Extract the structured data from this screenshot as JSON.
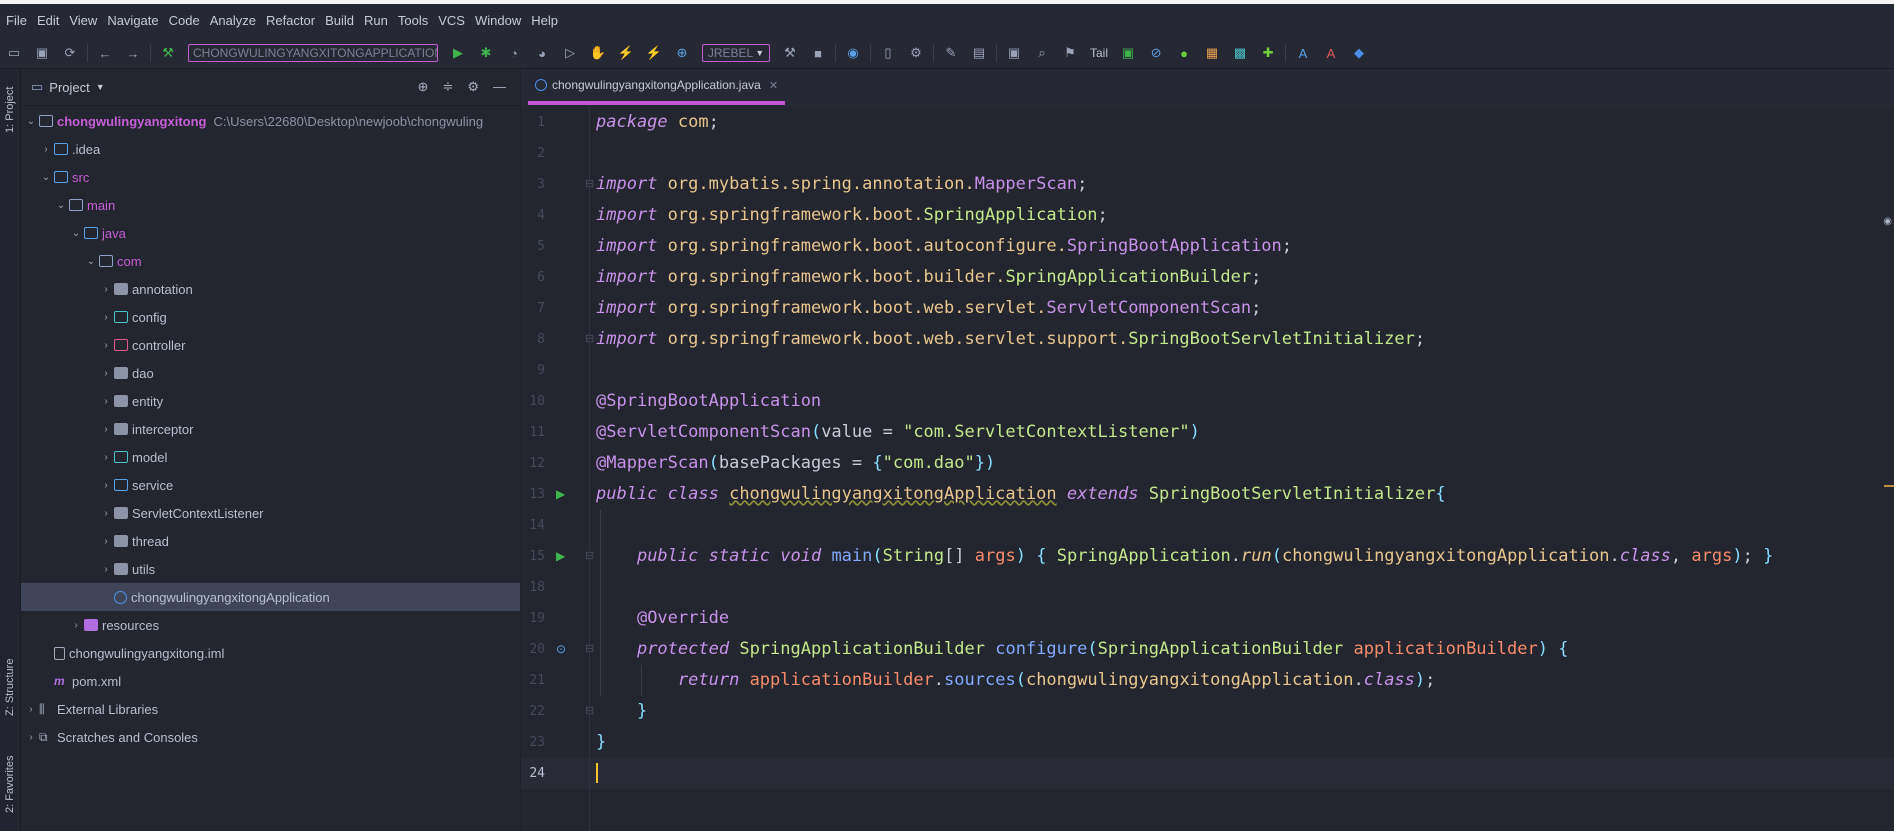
{
  "menu": [
    "File",
    "Edit",
    "View",
    "Navigate",
    "Code",
    "Analyze",
    "Refactor",
    "Build",
    "Run",
    "Tools",
    "VCS",
    "Window",
    "Help"
  ],
  "toolbar": {
    "run_config": "CHONGWULINGYANGXITONGAPPLICATION",
    "jrebel": "JREBEL",
    "tail": "Tail"
  },
  "left_strip": {
    "project_tab": "1: Project",
    "structure_tab": "Z: Structure",
    "favorites_tab": "2: Favorites"
  },
  "project_panel": {
    "title": "Project",
    "tree": [
      {
        "label": "chongwulingyangxitong",
        "path": "C:\\Users\\22680\\Desktop\\newjoob\\chongwuling",
        "depth": 0,
        "expanded": true,
        "icon": "folder-icon"
      },
      {
        "label": ".idea",
        "depth": 1,
        "expanded": false,
        "icon": "folder-blue-icon"
      },
      {
        "label": "src",
        "depth": 1,
        "expanded": true,
        "icon": "folder-src-icon"
      },
      {
        "label": "main",
        "depth": 2,
        "expanded": true,
        "icon": "folder-icon"
      },
      {
        "label": "java",
        "depth": 3,
        "expanded": true,
        "icon": "folder-blue-icon"
      },
      {
        "label": "com",
        "depth": 4,
        "expanded": true,
        "icon": "folder-icon"
      },
      {
        "label": "annotation",
        "depth": 5,
        "expanded": false,
        "icon": "package-icon"
      },
      {
        "label": "config",
        "depth": 5,
        "expanded": false,
        "icon": "package-config-icon"
      },
      {
        "label": "controller",
        "depth": 5,
        "expanded": false,
        "icon": "package-controller-icon"
      },
      {
        "label": "dao",
        "depth": 5,
        "expanded": false,
        "icon": "package-icon"
      },
      {
        "label": "entity",
        "depth": 5,
        "expanded": false,
        "icon": "package-icon"
      },
      {
        "label": "interceptor",
        "depth": 5,
        "expanded": false,
        "icon": "package-icon"
      },
      {
        "label": "model",
        "depth": 5,
        "expanded": false,
        "icon": "package-model-icon"
      },
      {
        "label": "service",
        "depth": 5,
        "expanded": false,
        "icon": "package-service-icon"
      },
      {
        "label": "ServletContextListener",
        "depth": 5,
        "expanded": false,
        "icon": "package-icon"
      },
      {
        "label": "thread",
        "depth": 5,
        "expanded": false,
        "icon": "package-icon"
      },
      {
        "label": "utils",
        "depth": 5,
        "expanded": false,
        "icon": "package-icon"
      },
      {
        "label": "chongwulingyangxitongApplication",
        "depth": 5,
        "leaf": true,
        "selected": true,
        "icon": "spring-class-icon"
      },
      {
        "label": "resources",
        "depth": 3,
        "expanded": false,
        "icon": "resources-folder-icon"
      },
      {
        "label": "chongwulingyangxitong.iml",
        "depth": 1,
        "leaf": true,
        "icon": "iml-file-icon"
      },
      {
        "label": "pom.xml",
        "depth": 1,
        "leaf": true,
        "icon": "maven-icon"
      },
      {
        "label": "External Libraries",
        "depth": 0,
        "expanded": false,
        "icon": "library-icon"
      },
      {
        "label": "Scratches and Consoles",
        "depth": 0,
        "expanded": false,
        "icon": "scratches-icon"
      }
    ]
  },
  "editor": {
    "tab_label": "chongwulingyangxitongApplication.java",
    "current_line": 24,
    "lines": [
      {
        "n": 1,
        "tokens": [
          [
            "kw",
            "package"
          ],
          [
            "plain",
            " "
          ],
          [
            "pkg",
            "com"
          ],
          [
            "plain",
            ";"
          ]
        ]
      },
      {
        "n": 2,
        "tokens": []
      },
      {
        "n": 3,
        "tokens": [
          [
            "kw",
            "import"
          ],
          [
            "plain",
            " "
          ],
          [
            "pkg",
            "org.mybatis.spring.annotation."
          ],
          [
            "ann",
            "MapperScan"
          ],
          [
            "plain",
            ";"
          ]
        ]
      },
      {
        "n": 4,
        "tokens": [
          [
            "kw",
            "import"
          ],
          [
            "plain",
            " "
          ],
          [
            "pkg",
            "org.springframework.boot."
          ],
          [
            "cls",
            "SpringApplication"
          ],
          [
            "plain",
            ";"
          ]
        ]
      },
      {
        "n": 5,
        "tokens": [
          [
            "kw",
            "import"
          ],
          [
            "plain",
            " "
          ],
          [
            "pkg",
            "org.springframework.boot.autoconfigure."
          ],
          [
            "ann",
            "SpringBootApplication"
          ],
          [
            "plain",
            ";"
          ]
        ]
      },
      {
        "n": 6,
        "tokens": [
          [
            "kw",
            "import"
          ],
          [
            "plain",
            " "
          ],
          [
            "pkg",
            "org.springframework.boot.builder."
          ],
          [
            "cls",
            "SpringApplicationBuilder"
          ],
          [
            "plain",
            ";"
          ]
        ]
      },
      {
        "n": 7,
        "tokens": [
          [
            "kw",
            "import"
          ],
          [
            "plain",
            " "
          ],
          [
            "pkg",
            "org.springframework.boot.web.servlet."
          ],
          [
            "ann",
            "ServletComponentScan"
          ],
          [
            "plain",
            ";"
          ]
        ]
      },
      {
        "n": 8,
        "tokens": [
          [
            "kw",
            "import"
          ],
          [
            "plain",
            " "
          ],
          [
            "pkg",
            "org.springframework.boot.web.servlet.support."
          ],
          [
            "cls",
            "SpringBootServletInitializer"
          ],
          [
            "plain",
            ";"
          ]
        ]
      },
      {
        "n": 9,
        "tokens": []
      },
      {
        "n": 10,
        "tokens": [
          [
            "ann",
            "@SpringBootApplication"
          ]
        ]
      },
      {
        "n": 11,
        "tokens": [
          [
            "ann",
            "@ServletComponentScan"
          ],
          [
            "brace",
            "("
          ],
          [
            "plain",
            "value = "
          ],
          [
            "str",
            "\"com.ServletContextListener\""
          ],
          [
            "brace",
            ")"
          ]
        ]
      },
      {
        "n": 12,
        "tokens": [
          [
            "ann",
            "@MapperScan"
          ],
          [
            "brace",
            "("
          ],
          [
            "plain",
            "basePackages = "
          ],
          [
            "brace",
            "{"
          ],
          [
            "str",
            "\"com.dao\""
          ],
          [
            "brace",
            "})"
          ]
        ]
      },
      {
        "n": 13,
        "tokens": [
          [
            "kw",
            "public class"
          ],
          [
            "plain",
            " "
          ],
          [
            "clsdecl",
            "chongwulingyangxitongApplication"
          ],
          [
            "plain",
            " "
          ],
          [
            "kw",
            "extends"
          ],
          [
            "plain",
            " "
          ],
          [
            "cls",
            "SpringBootServletInitializer"
          ],
          [
            "brace",
            "{"
          ]
        ]
      },
      {
        "n": 14,
        "tokens": []
      },
      {
        "n": 15,
        "tokens": [
          [
            "plain",
            "    "
          ],
          [
            "kw",
            "public static void"
          ],
          [
            "plain",
            " "
          ],
          [
            "fn",
            "main"
          ],
          [
            "brace",
            "("
          ],
          [
            "cls",
            "String"
          ],
          [
            "plain",
            "[] "
          ],
          [
            "param",
            "args"
          ],
          [
            "brace",
            ")"
          ],
          [
            "plain",
            " "
          ],
          [
            "brace",
            "{"
          ],
          [
            "plain",
            " "
          ],
          [
            "cls",
            "SpringApplication"
          ],
          [
            "plain",
            "."
          ],
          [
            "fnit",
            "run"
          ],
          [
            "brace",
            "("
          ],
          [
            "pkg",
            "chongwulingyangxitongApplication"
          ],
          [
            "plain",
            "."
          ],
          [
            "kw",
            "class"
          ],
          [
            "plain",
            ", "
          ],
          [
            "param",
            "args"
          ],
          [
            "brace",
            ")"
          ],
          [
            "plain",
            "; "
          ],
          [
            "brace",
            "}"
          ]
        ]
      },
      {
        "n": 18,
        "tokens": []
      },
      {
        "n": 19,
        "tokens": [
          [
            "plain",
            "    "
          ],
          [
            "ann",
            "@Override"
          ]
        ]
      },
      {
        "n": 20,
        "tokens": [
          [
            "plain",
            "    "
          ],
          [
            "kw",
            "protected"
          ],
          [
            "plain",
            " "
          ],
          [
            "cls",
            "SpringApplicationBuilder"
          ],
          [
            "plain",
            " "
          ],
          [
            "fn",
            "configure"
          ],
          [
            "brace",
            "("
          ],
          [
            "cls",
            "SpringApplicationBuilder"
          ],
          [
            "plain",
            " "
          ],
          [
            "param",
            "applicationBuilder"
          ],
          [
            "brace",
            ")"
          ],
          [
            "plain",
            " "
          ],
          [
            "brace",
            "{"
          ]
        ]
      },
      {
        "n": 21,
        "tokens": [
          [
            "plain",
            "        "
          ],
          [
            "kw",
            "return"
          ],
          [
            "plain",
            " "
          ],
          [
            "param",
            "applicationBuilder"
          ],
          [
            "plain",
            "."
          ],
          [
            "fn",
            "sources"
          ],
          [
            "brace",
            "("
          ],
          [
            "pkg",
            "chongwulingyangxitongApplication"
          ],
          [
            "plain",
            "."
          ],
          [
            "kw",
            "class"
          ],
          [
            "brace",
            ")"
          ],
          [
            "plain",
            ";"
          ]
        ]
      },
      {
        "n": 22,
        "tokens": [
          [
            "plain",
            "    "
          ],
          [
            "brace",
            "}"
          ]
        ]
      },
      {
        "n": 23,
        "tokens": [
          [
            "brace",
            "}"
          ]
        ]
      },
      {
        "n": 24,
        "tokens": []
      }
    ]
  }
}
